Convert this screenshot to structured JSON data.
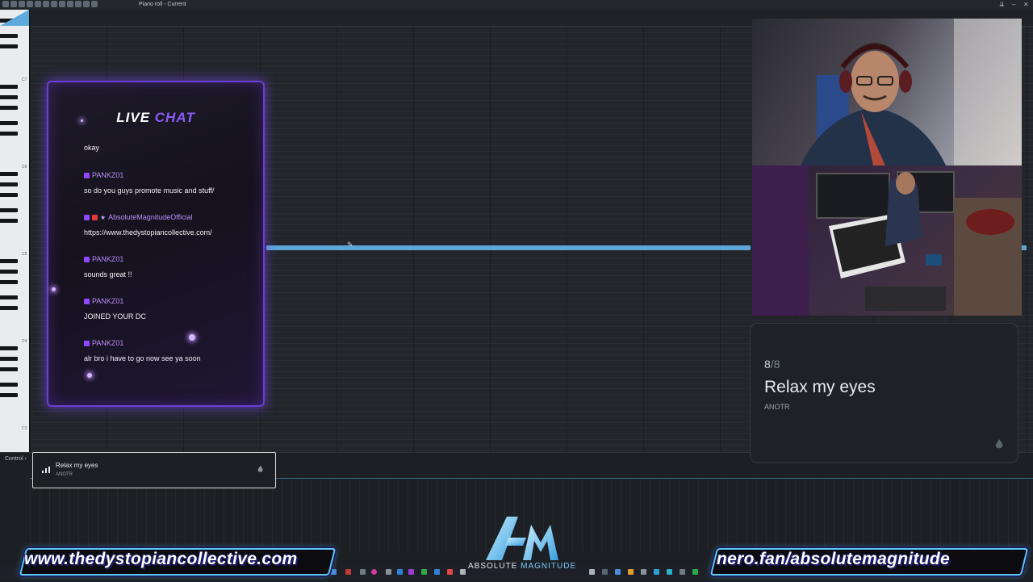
{
  "window": {
    "title": "Piano roll - Current",
    "controls": [
      "⇊",
      "–",
      "✕"
    ]
  },
  "piano_roll": {
    "octave_labels": [
      "C7",
      "C6",
      "C5",
      "C4",
      "C3"
    ]
  },
  "control": {
    "label": "Control",
    "arrow": "›"
  },
  "chat": {
    "title_main": "LIVE",
    "title_accent": "CHAT",
    "messages": [
      {
        "user": "",
        "text": "okay"
      },
      {
        "user": "PANKZ01",
        "text": "so do you guys promote music and stuff/"
      },
      {
        "user": "AbsoluteMagnitudeOfficial",
        "text": "https://www.thedystopiancollective.com/"
      },
      {
        "user": "PANKZ01",
        "text": "sounds great !!"
      },
      {
        "user": "PANKZ01",
        "text": "JOINED YOUR DC"
      },
      {
        "user": "PANKZ01",
        "text": "alr bro i have to go now see ya soon"
      }
    ]
  },
  "now_playing": {
    "track_current": "8",
    "track_sep": "/",
    "track_total": "8",
    "title": "Relax my eyes",
    "artist": "ANOTR"
  },
  "mini_player": {
    "title": "Relax my eyes",
    "artist": "ANOTR"
  },
  "banners": {
    "left": "www.thedystopiancollective.com",
    "right": "nero.fan/absolutemagnitude"
  },
  "logo": {
    "text_main": "ABSOLUTE",
    "text_accent": "MAGNITUDE"
  },
  "colors": {
    "accent_blue": "#5fa6d8",
    "chat_purple": "#8b5cf6",
    "banner_border": "#5ec8f3"
  }
}
